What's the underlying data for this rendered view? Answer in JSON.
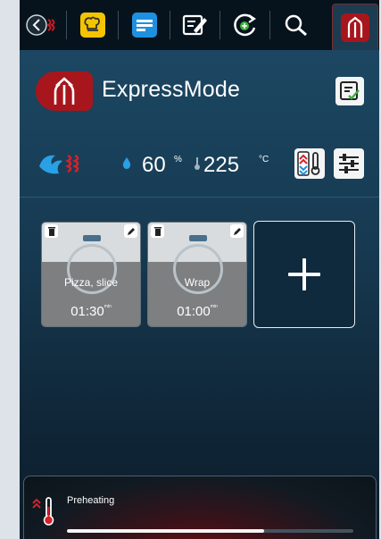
{
  "header": {
    "title": "ExpressMode"
  },
  "climate": {
    "humidity_value": "60",
    "humidity_unit": "%",
    "temperature_value": "225",
    "temperature_unit": "°C"
  },
  "programs": [
    {
      "name": "Pizza, slice",
      "time": "01:30",
      "time_unit": "min"
    },
    {
      "name": "Wrap",
      "time": "01:00",
      "time_unit": "min"
    }
  ],
  "status": {
    "label": "Preheating",
    "progress": 0.69
  },
  "colors": {
    "brand_red": "#a7161c",
    "tab_yellow": "#f5c400",
    "tab_blue": "#1e90e0",
    "accent_green": "#3cae3c"
  },
  "icons": {
    "back": "back-chevron-icon",
    "chef": "chef-hat-icon",
    "list": "program-list-icon",
    "edit": "edit-note-icon",
    "clean": "cleaning-icon",
    "search": "search-icon",
    "brand": "brand-logo-icon"
  }
}
